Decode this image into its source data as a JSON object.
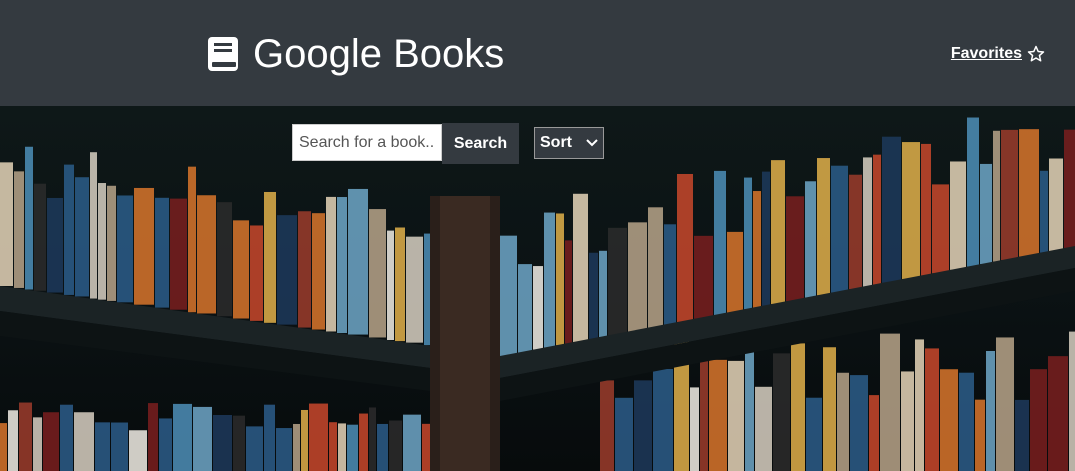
{
  "navbar": {
    "brand_title": "Google Books",
    "brand_icon": "book-icon",
    "favorites_label": "Favorites",
    "favorites_icon": "star-outline-icon"
  },
  "search": {
    "placeholder": "Search for a book..",
    "value": "",
    "button_label": "Search"
  },
  "sort": {
    "selected": "Sort"
  },
  "hero": {
    "image_description_icon": "bookshelf-background-image"
  },
  "colors": {
    "navbar_bg": "#343a40",
    "text_light": "#ffffff"
  }
}
